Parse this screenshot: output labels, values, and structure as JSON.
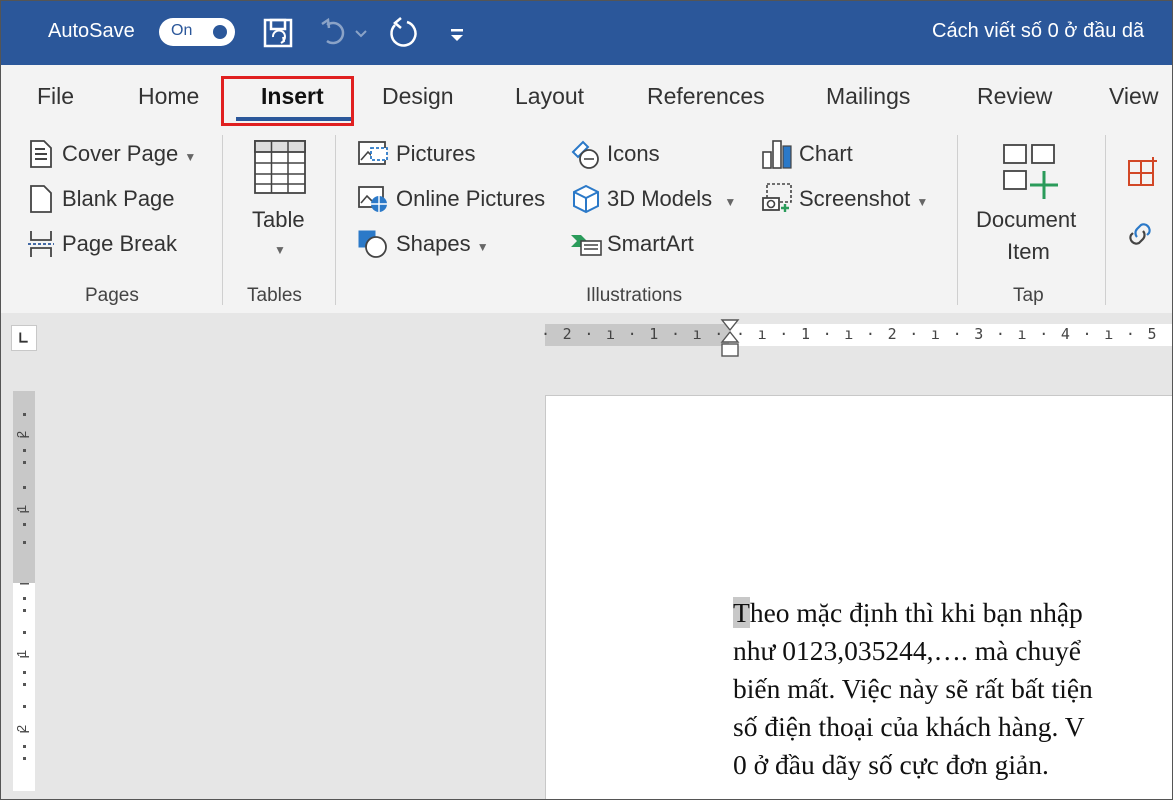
{
  "titlebar": {
    "autosave_label": "AutoSave",
    "autosave_state": "On",
    "quick_access": [
      "save-icon",
      "undo-icon",
      "redo-icon",
      "customize-icon"
    ],
    "document_title": "Cách viết số 0 ở đầu dã"
  },
  "tabs": {
    "items": [
      "File",
      "Home",
      "Insert",
      "Design",
      "Layout",
      "References",
      "Mailings",
      "Review",
      "View"
    ],
    "active": "Insert"
  },
  "ribbon": {
    "pages": {
      "cover_page": "Cover Page",
      "blank_page": "Blank Page",
      "page_break": "Page Break",
      "label": "Pages"
    },
    "tables": {
      "table": "Table",
      "label": "Tables"
    },
    "illustrations": {
      "pictures": "Pictures",
      "online_pictures": "Online Pictures",
      "shapes": "Shapes",
      "icons": "Icons",
      "models_3d": "3D Models",
      "smartart": "SmartArt",
      "chart": "Chart",
      "screenshot": "Screenshot",
      "label": "Illustrations"
    },
    "tap": {
      "document_item_line1": "Document",
      "document_item_line2": "Item",
      "label": "Tap"
    }
  },
  "ruler": {
    "horizontal_marks": "· 2 · ı · 1 · ı ·   · ı · 1 · ı · 2 · ı · 3 · ı · 4 · ı · 5 · ı ·",
    "vertical_marks": [
      "2",
      "1",
      "1",
      "2"
    ]
  },
  "document": {
    "first_char": "T",
    "lines": [
      "heo mặc định thì khi bạn nhập",
      "như 0123,035244,…. mà chuyể",
      "biến mất. Việc này sẽ rất bất tiện",
      "số điện thoại của khách hàng. V",
      "0 ở đầu dãy số cực đơn giản."
    ]
  },
  "colors": {
    "title_bar": "#2b579a",
    "ribbon_bg": "#f3f3f3",
    "highlight_box": "#e02020"
  }
}
